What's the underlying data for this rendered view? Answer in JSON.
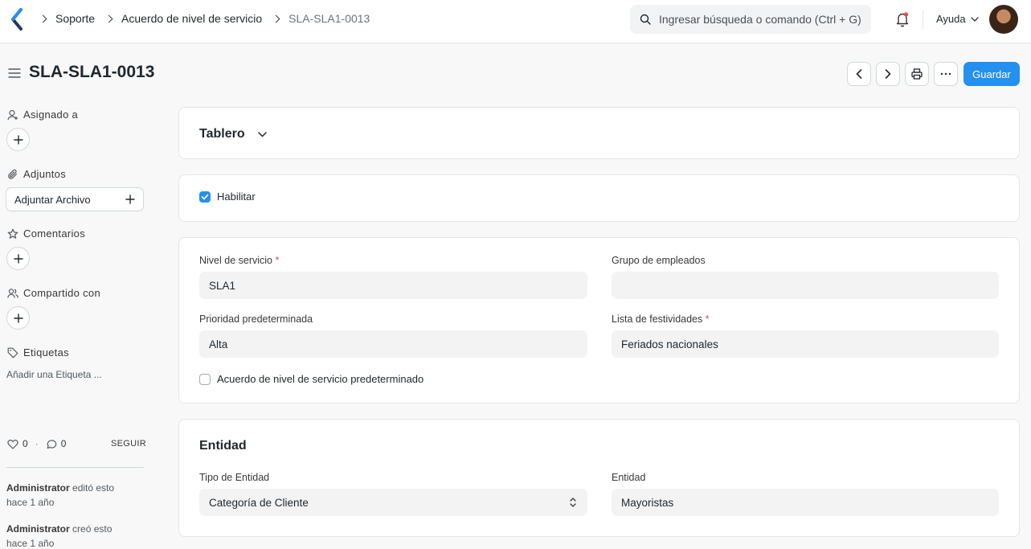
{
  "navbar": {
    "breadcrumbs": [
      "Soporte",
      "Acuerdo de nivel de servicio",
      "SLA-SLA1-0013"
    ],
    "search_placeholder": "Ingresar búsqueda o comando (Ctrl + G)",
    "help_label": "Ayuda",
    "icons": [
      "app-logo-icon",
      "search-icon",
      "notification-bell-icon",
      "chevron-down-icon",
      "user-avatar"
    ]
  },
  "page": {
    "title": "SLA-SLA1-0013",
    "save_label": "Guardar",
    "actions": [
      "previous-record-icon",
      "next-record-icon",
      "print-icon",
      "more-options-icon"
    ],
    "accent_color": "#2490ef"
  },
  "sidebar": {
    "assigned_label": "Asignado a",
    "attachments_label": "Adjuntos",
    "attach_button": "Adjuntar Archivo",
    "comments_label": "Comentarios",
    "shared_label": "Compartido con",
    "tags_label": "Etiquetas",
    "tags_add": "Añadir una Etiqueta ...",
    "likes_count": "0",
    "comments_count": "0",
    "dot": "·",
    "follow_label": "SEGUIR",
    "activity": [
      {
        "user": "Administrator",
        "action": "editó esto",
        "time": "hace 1 año"
      },
      {
        "user": "Administrator",
        "action": "creó esto",
        "time": "hace 1 año"
      }
    ]
  },
  "dashboard": {
    "heading": "Tablero"
  },
  "enable": {
    "label": "Habilitar",
    "checked": true
  },
  "details": {
    "service_level_label": "Nivel de servicio",
    "service_level_value": "SLA1",
    "employee_group_label": "Grupo de empleados",
    "employee_group_value": "",
    "default_priority_label": "Prioridad predeterminada",
    "default_priority_value": "Alta",
    "holiday_list_label": "Lista de festividades",
    "holiday_list_value": "Feriados nacionales",
    "default_sla_label": "Acuerdo de nivel de servicio predeterminado",
    "default_sla_checked": false,
    "required_mark": "*"
  },
  "entity": {
    "heading": "Entidad",
    "entity_type_label": "Tipo de Entidad",
    "entity_type_value": "Categoría de Cliente",
    "entity_label": "Entidad",
    "entity_value": "Mayoristas"
  }
}
